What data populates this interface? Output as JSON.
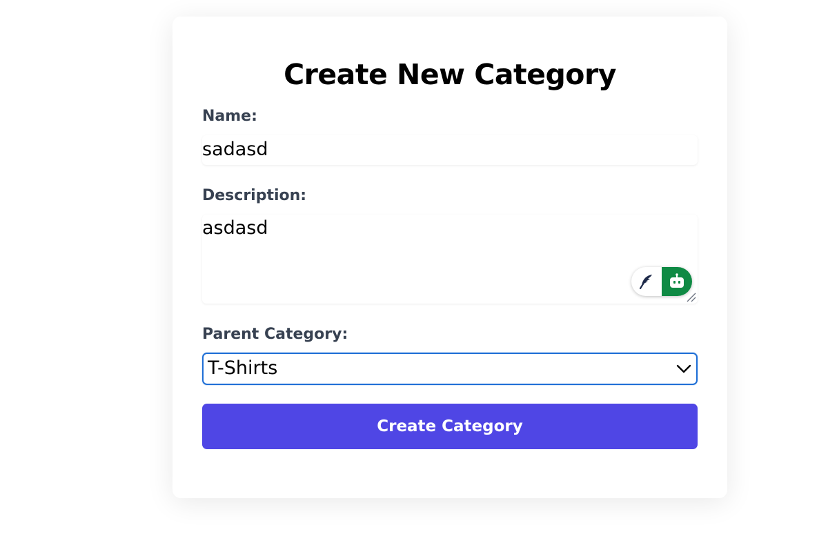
{
  "form": {
    "title": "Create New Category",
    "name_label": "Name:",
    "name_value": "sadasd",
    "description_label": "Description:",
    "description_value": "asdasd",
    "parent_label": "Parent Category:",
    "parent_selected": "T-Shirts",
    "submit_label": "Create Category"
  },
  "widget": {
    "left_icon": "feather-icon",
    "right_icon": "robot-icon"
  },
  "colors": {
    "accent_button": "#4f46e5",
    "focus_border": "#1f6fd6",
    "widget_green": "#0f8a44",
    "label_text": "#374151"
  }
}
